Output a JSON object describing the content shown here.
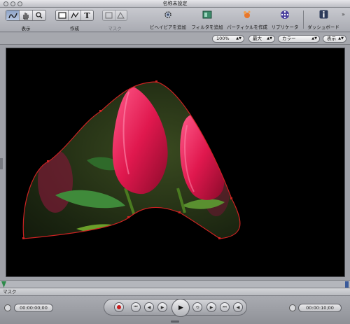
{
  "window": {
    "title": "名称未設定"
  },
  "toolbar": {
    "view_group_label": "表示",
    "create_group_label": "作成",
    "mask_group_label": "マスク",
    "add_behavior_label": "ビヘイビアを追加",
    "add_filter_label": "フィルタを追加",
    "create_particle_label": "パーティクルを作成",
    "replicator_label": "リプリケータ",
    "dashboard_label": "ダッシュボード",
    "icons": [
      "bezier-icon",
      "hand-icon",
      "magnifier-icon",
      "rectangle-icon",
      "pen-icon",
      "text-icon",
      "mask-rect-icon",
      "mask-shape-icon",
      "gear-icon",
      "filter-icon",
      "particle-icon",
      "replicator-icon",
      "info-icon",
      "overflow-chevron-icon"
    ]
  },
  "options": {
    "zoom": "100%",
    "resolution": "最大",
    "channels": "カラー",
    "view": "表示"
  },
  "timeline": {
    "tab_label": "マスク"
  },
  "transport": {
    "current_time": "00:00:00;00",
    "duration": "00:00:10;00"
  },
  "colors": {
    "mask_outline": "#cc2222",
    "viewer_background": "#000000",
    "chrome": "#a6a8ae"
  }
}
